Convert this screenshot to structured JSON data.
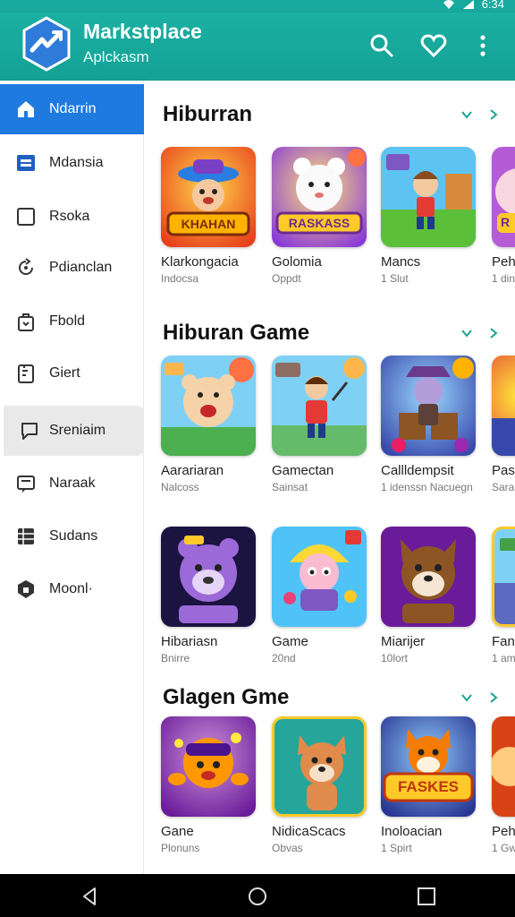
{
  "status_bar": {
    "time_text": "6:34"
  },
  "header": {
    "title": "Markstplace",
    "subtitle": "Aplckasm",
    "icons": [
      "search-icon",
      "heart-icon",
      "more-vert-icon"
    ]
  },
  "sidebar": {
    "items": [
      {
        "label": "Ndarrin",
        "icon": "home-icon"
      },
      {
        "label": "Mdansia",
        "icon": "window-icon"
      },
      {
        "label": "Rsoka",
        "icon": "square-icon"
      },
      {
        "label": "Pdianclan",
        "icon": "refresh-icon"
      },
      {
        "label": "Fbold",
        "icon": "bag-icon"
      },
      {
        "label": "Giert",
        "icon": "document-icon"
      },
      {
        "label": "Sreniaim",
        "icon": "chat-icon"
      },
      {
        "label": "Naraak",
        "icon": "message-icon"
      },
      {
        "label": "Sudans",
        "icon": "grid-icon"
      },
      {
        "label": "Moonl·",
        "icon": "shield-icon"
      }
    ]
  },
  "sections": [
    {
      "title": "Hiburran",
      "cards": [
        {
          "name": "Klarkongacia",
          "meta": "Indocsa",
          "badge": "KHAHAN"
        },
        {
          "name": "Golomia",
          "meta": "Oppdt",
          "badge": "RASKASS"
        },
        {
          "name": "Mancs",
          "meta": "1 Slut",
          "badge": ""
        },
        {
          "name": "Peh",
          "meta": "1 din",
          "badge": "R"
        }
      ]
    },
    {
      "title": "Hiburan Game",
      "cards": [
        {
          "name": "Aarariaran",
          "meta": "Nalcoss",
          "badge": ""
        },
        {
          "name": "Gamectan",
          "meta": "Sainsat",
          "badge": ""
        },
        {
          "name": "Callldempsit",
          "meta": "1 idenssn Nacuegn",
          "badge": ""
        },
        {
          "name": "Pas",
          "meta": "Sara",
          "badge": ""
        },
        {
          "name": "Hibariasn",
          "meta": "Bnirre",
          "badge": ""
        },
        {
          "name": "Game",
          "meta": "20nd",
          "badge": ""
        },
        {
          "name": "Miarijer",
          "meta": "10lort",
          "badge": ""
        },
        {
          "name": "Fan",
          "meta": "1 am",
          "badge": ""
        }
      ]
    },
    {
      "title": "Glagen Gme",
      "cards": [
        {
          "name": "Gane",
          "meta": "Plonuns",
          "badge": ""
        },
        {
          "name": "NidicaScacs",
          "meta": "Obvas",
          "badge": ""
        },
        {
          "name": "Inoloacian",
          "meta": "1 Spirt",
          "badge": "FASKES"
        },
        {
          "name": "Peh",
          "meta": "1 Gw",
          "badge": ""
        }
      ]
    }
  ],
  "colors": {
    "teal": "#17a99d",
    "active_blue": "#1f7ae0",
    "selected_gray": "#e9e9e9"
  }
}
